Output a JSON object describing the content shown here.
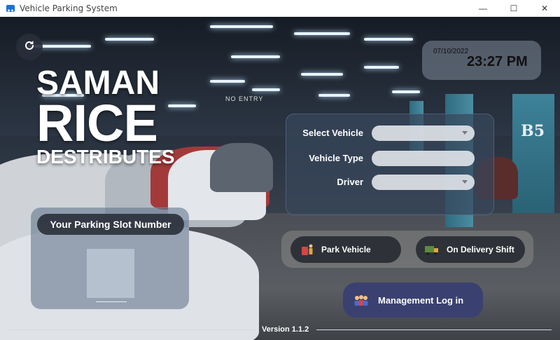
{
  "window": {
    "title": "Vehicle Parking System",
    "controls": {
      "minimize": "—",
      "maximize": "☐",
      "close": "✕"
    }
  },
  "scene": {
    "no_entry": "NO ENTRY",
    "wall_label": "B5"
  },
  "brand": {
    "line1": "SAMAN",
    "line2": "RICE",
    "line3": "DESTRIBUTES"
  },
  "clock": {
    "date": "07/10/2022",
    "time": "23:27 PM"
  },
  "form": {
    "select_vehicle_label": "Select Vehicle",
    "vehicle_type_label": "Vehicle Type",
    "driver_label": "Driver",
    "select_vehicle_value": "",
    "vehicle_type_value": "",
    "driver_value": ""
  },
  "slot": {
    "title": "Your Parking Slot Number",
    "value": ""
  },
  "actions": {
    "park": "Park Vehicle",
    "delivery": "On Delivery Shift",
    "management": "Management Log in"
  },
  "footer": {
    "version": "Version 1.1.2"
  },
  "colors": {
    "accent": "#3a4170",
    "pill": "#2e3238",
    "panel": "#37465c"
  },
  "icons": [
    "refresh-icon",
    "park-vehicle-icon",
    "delivery-truck-icon",
    "management-group-icon",
    "app-icon"
  ]
}
